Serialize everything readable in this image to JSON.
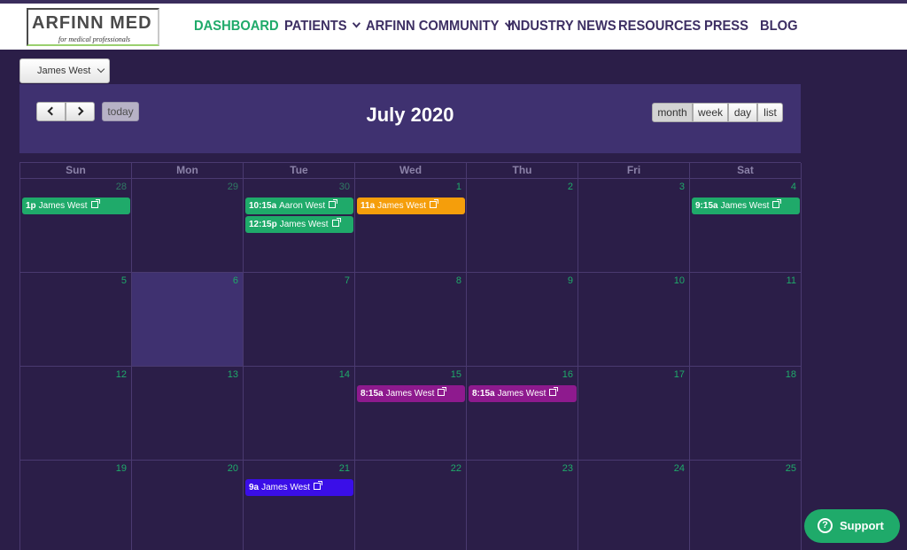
{
  "logo": {
    "title": "ARFINN MED",
    "tagline": "for medical professionals"
  },
  "nav": [
    {
      "label": "DASHBOARD",
      "active": true,
      "dropdown": false
    },
    {
      "label": "PATIENTS",
      "active": false,
      "dropdown": true
    },
    {
      "label": "ARFINN COMMUNITY",
      "active": false,
      "dropdown": true
    },
    {
      "label": "INDUSTRY NEWS",
      "active": false,
      "dropdown": false
    },
    {
      "label": "RESOURCES",
      "active": false,
      "dropdown": false
    },
    {
      "label": "PRESS",
      "active": false,
      "dropdown": false
    },
    {
      "label": "BLOG",
      "active": false,
      "dropdown": false
    }
  ],
  "user_select": {
    "value": "James West"
  },
  "toolbar": {
    "today_label": "today",
    "title": "July 2020",
    "views": [
      "month",
      "week",
      "day",
      "list"
    ],
    "active_view": "month"
  },
  "calendar": {
    "weekdays": [
      "Sun",
      "Mon",
      "Tue",
      "Wed",
      "Thu",
      "Fri",
      "Sat"
    ],
    "weeks": [
      [
        {
          "day": "28",
          "other": true,
          "events": [
            {
              "time": "1p",
              "title": "James West",
              "color": "#1faa6a"
            }
          ]
        },
        {
          "day": "29",
          "other": true,
          "events": []
        },
        {
          "day": "30",
          "other": true,
          "events": [
            {
              "time": "10:15a",
              "title": "Aaron West",
              "color": "#1faa6a"
            },
            {
              "time": "12:15p",
              "title": "James West",
              "color": "#1faa6a"
            }
          ]
        },
        {
          "day": "1",
          "other": false,
          "events": [
            {
              "time": "11a",
              "title": "James West",
              "color": "#f59e0b"
            }
          ]
        },
        {
          "day": "2",
          "other": false,
          "events": []
        },
        {
          "day": "3",
          "other": false,
          "events": []
        },
        {
          "day": "4",
          "other": false,
          "events": [
            {
              "time": "9:15a",
              "title": "James West",
              "color": "#1faa6a"
            }
          ]
        }
      ],
      [
        {
          "day": "5",
          "other": false,
          "events": []
        },
        {
          "day": "6",
          "other": false,
          "today": true,
          "events": []
        },
        {
          "day": "7",
          "other": false,
          "events": []
        },
        {
          "day": "8",
          "other": false,
          "events": []
        },
        {
          "day": "9",
          "other": false,
          "events": []
        },
        {
          "day": "10",
          "other": false,
          "events": []
        },
        {
          "day": "11",
          "other": false,
          "events": []
        }
      ],
      [
        {
          "day": "12",
          "other": false,
          "events": []
        },
        {
          "day": "13",
          "other": false,
          "events": []
        },
        {
          "day": "14",
          "other": false,
          "events": []
        },
        {
          "day": "15",
          "other": false,
          "events": [
            {
              "time": "8:15a",
              "title": "James West",
              "color": "#8e1a8e"
            }
          ]
        },
        {
          "day": "16",
          "other": false,
          "events": [
            {
              "time": "8:15a",
              "title": "James West",
              "color": "#8e1a8e"
            }
          ]
        },
        {
          "day": "17",
          "other": false,
          "events": []
        },
        {
          "day": "18",
          "other": false,
          "events": []
        }
      ],
      [
        {
          "day": "19",
          "other": false,
          "events": []
        },
        {
          "day": "20",
          "other": false,
          "events": []
        },
        {
          "day": "21",
          "other": false,
          "events": [
            {
              "time": "9a",
              "title": "James West",
              "color": "#3a0ee8"
            }
          ]
        },
        {
          "day": "22",
          "other": false,
          "events": []
        },
        {
          "day": "23",
          "other": false,
          "events": []
        },
        {
          "day": "24",
          "other": false,
          "events": []
        },
        {
          "day": "25",
          "other": false,
          "events": []
        }
      ]
    ]
  },
  "support": {
    "label": "Support",
    "icon": "question-circle-icon"
  }
}
